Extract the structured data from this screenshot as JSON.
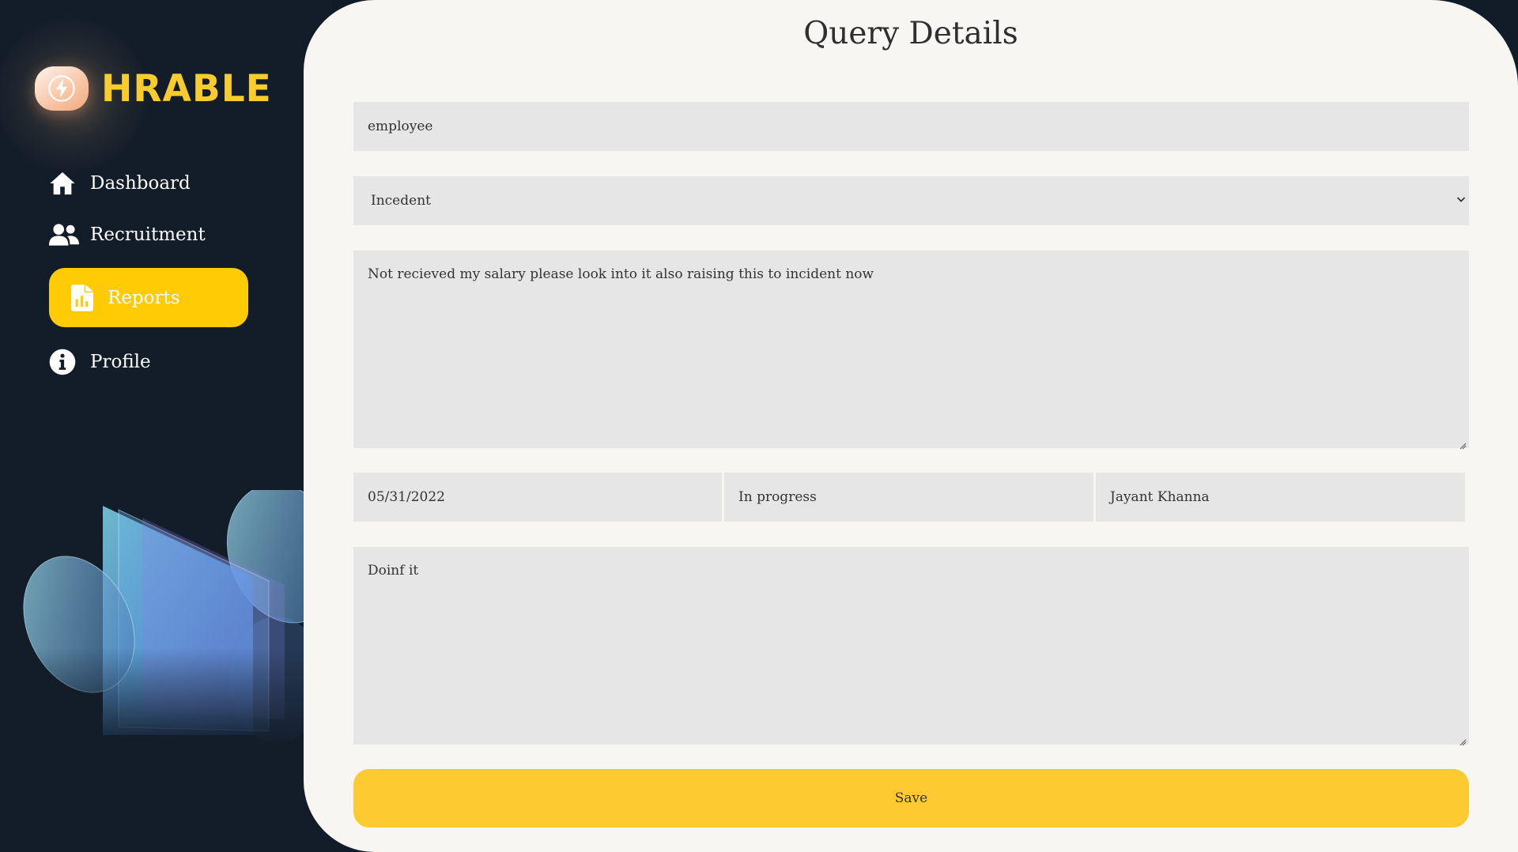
{
  "app": {
    "logo_text": "HRABLE"
  },
  "sidebar": {
    "items": [
      {
        "label": "Dashboard",
        "icon": "home-icon"
      },
      {
        "label": "Recruitment",
        "icon": "users-icon"
      },
      {
        "label": "Reports",
        "icon": "file-chart-icon",
        "active": true
      },
      {
        "label": "Profile",
        "icon": "info-icon"
      }
    ]
  },
  "page": {
    "title": "Query Details"
  },
  "form": {
    "type_value": "employee",
    "category_value": "Incedent",
    "description_value": "Not recieved my salary please look into  it also raising this to incident now",
    "date_value": "05/31/2022",
    "status_value": "In progress",
    "assignee_value": "Jayant Khanna",
    "comment_value": "Doinf it",
    "save_label": "Save"
  },
  "colors": {
    "sidebar_bg": "#131d2a",
    "accent": "#ffcb05",
    "logo_text": "#f8cb2e",
    "panel_bg": "#f7f6f2",
    "field_bg": "#e6e6e6",
    "save_button": "#fdca31"
  }
}
